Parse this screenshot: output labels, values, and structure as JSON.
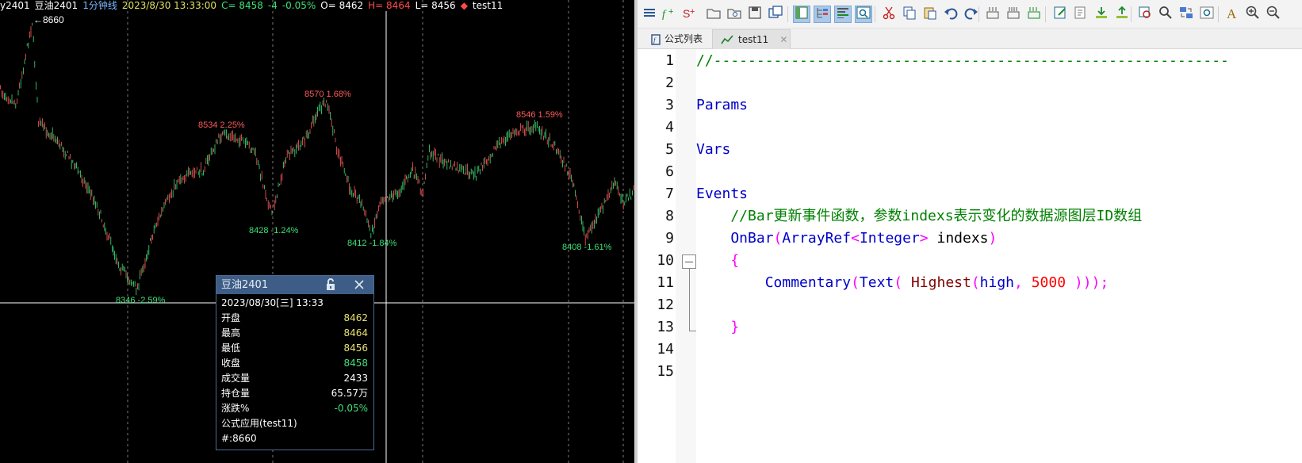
{
  "chart": {
    "header": {
      "symbol": "y2401",
      "name": "豆油2401",
      "period": "1分钟线",
      "datetime": "2023/8/30 13:33:00",
      "close_label": "C= 8458",
      "change": "-4",
      "change_pct": "-0.05%",
      "open_label": "O= 8462",
      "high_label": "H= 8464",
      "low_label": "L= 8456",
      "indicator": "test11"
    },
    "high_marker": "8660",
    "peak_labels": [
      {
        "text": "8534 2.25%",
        "kind": "high"
      },
      {
        "text": "8570 1.68%",
        "kind": "high"
      },
      {
        "text": "8546 1.59%",
        "kind": "high"
      },
      {
        "text": "8346 -2.59%",
        "kind": "low"
      },
      {
        "text": "8428 -1.24%",
        "kind": "low"
      },
      {
        "text": "8412 -1.84%",
        "kind": "low"
      },
      {
        "text": "8408 -1.61%",
        "kind": "low"
      }
    ],
    "colors": {
      "up": "#ff5a5a",
      "down": "#3ee07a",
      "background": "#000000",
      "crosshair": "#ffffff"
    }
  },
  "tooltip": {
    "title": "豆油2401",
    "date": "2023/08/30[三] 13:33",
    "rows": [
      {
        "label": "开盘",
        "value": "8462",
        "color": "#e8e070"
      },
      {
        "label": "最高",
        "value": "8464",
        "color": "#e8e070"
      },
      {
        "label": "最低",
        "value": "8456",
        "color": "#e8e070"
      },
      {
        "label": "收盘",
        "value": "8458",
        "color": "#3ee07a"
      },
      {
        "label": "成交量",
        "value": "2433",
        "color": "#ffffff"
      },
      {
        "label": "持仓量",
        "value": "65.57万",
        "color": "#ffffff"
      },
      {
        "label": "涨跌%",
        "value": "-0.05%",
        "color": "#3ee07a"
      }
    ],
    "app": "公式应用(test11)",
    "extra": "#:8660"
  },
  "editor": {
    "tabs": [
      {
        "label": "公式列表"
      },
      {
        "label": "test11"
      }
    ],
    "toolbar_icons": [
      "list-icon",
      "fx-add-icon",
      "s-add-icon",
      "open-icon",
      "open-link-icon",
      "save-icon",
      "save-all-icon",
      "panel-icon",
      "tree-icon",
      "output-icon",
      "find-panel-icon",
      "cut-icon",
      "copy-icon",
      "paste-icon",
      "undo-icon",
      "redo-icon",
      "compile-icon",
      "compile-all-icon",
      "batch-icon",
      "edit-icon",
      "properties-icon",
      "import-icon",
      "export-icon",
      "locate-icon",
      "search-icon",
      "replace-icon",
      "goto-icon",
      "font-icon",
      "zoom-in-icon",
      "zoom-out-icon"
    ],
    "lines": [
      {
        "n": "1",
        "parts": [
          {
            "t": "//------------------------------------------------------------",
            "c": "cm"
          }
        ]
      },
      {
        "n": "2",
        "parts": []
      },
      {
        "n": "3",
        "parts": [
          {
            "t": "Params",
            "c": "kw"
          }
        ]
      },
      {
        "n": "4",
        "parts": []
      },
      {
        "n": "5",
        "parts": [
          {
            "t": "Vars",
            "c": "kw"
          }
        ]
      },
      {
        "n": "6",
        "parts": []
      },
      {
        "n": "7",
        "parts": [
          {
            "t": "Events",
            "c": "kw"
          }
        ]
      },
      {
        "n": "8",
        "parts": [
          {
            "t": "    //Bar更新事件函数，参数indexs表示变化的数据源图层ID数组",
            "c": "cm"
          }
        ]
      },
      {
        "n": "9",
        "parts": [
          {
            "t": "    OnBar",
            "c": "fn"
          },
          {
            "t": "(",
            "c": "op"
          },
          {
            "t": "ArrayRef",
            "c": "fn"
          },
          {
            "t": "<",
            "c": "op"
          },
          {
            "t": "Integer",
            "c": "fn"
          },
          {
            "t": ">",
            "c": "op"
          },
          {
            "t": " indexs",
            "c": "tx"
          },
          {
            "t": ")",
            "c": "op"
          }
        ]
      },
      {
        "n": "10",
        "parts": [
          {
            "t": "    {",
            "c": "br"
          }
        ]
      },
      {
        "n": "11",
        "parts": [
          {
            "t": "        Commentary",
            "c": "fn"
          },
          {
            "t": "(",
            "c": "op"
          },
          {
            "t": "Text",
            "c": "fn"
          },
          {
            "t": "( ",
            "c": "op"
          },
          {
            "t": "Highest",
            "c": "fn2"
          },
          {
            "t": "(",
            "c": "op"
          },
          {
            "t": "high",
            "c": "fn"
          },
          {
            "t": ", ",
            "c": "op"
          },
          {
            "t": "5000",
            "c": "nm"
          },
          {
            "t": " )));",
            "c": "op"
          }
        ]
      },
      {
        "n": "12",
        "parts": []
      },
      {
        "n": "13",
        "parts": [
          {
            "t": "    }",
            "c": "br"
          }
        ]
      },
      {
        "n": "14",
        "parts": []
      },
      {
        "n": "15",
        "parts": []
      }
    ]
  }
}
